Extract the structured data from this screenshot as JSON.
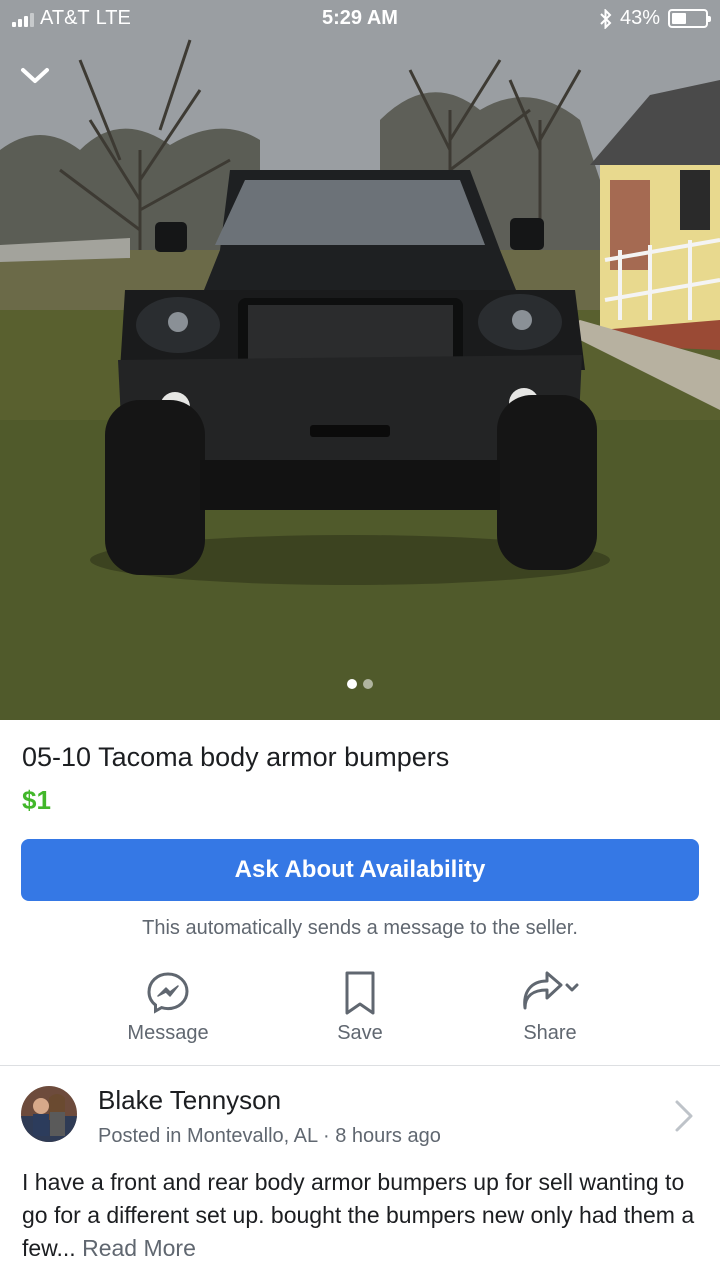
{
  "status_bar": {
    "carrier": "AT&T",
    "network": "LTE",
    "time": "5:29 AM",
    "battery_percent": "43%",
    "battery_level": 0.43
  },
  "photo": {
    "carousel_count": 2,
    "active_index": 0
  },
  "listing": {
    "title": "05-10 Tacoma body armor bumpers",
    "price": "$1",
    "ask_button": "Ask About Availability",
    "auto_note": "This automatically sends a message to the seller."
  },
  "actions": {
    "message": "Message",
    "save": "Save",
    "share": "Share"
  },
  "seller": {
    "name": "Blake Tennyson",
    "location": "Posted in Montevallo, AL",
    "separator": "·",
    "time_ago": "8 hours ago"
  },
  "description": {
    "text": "I have a front and rear body armor bumpers up for sell wanting to go for a different set up. bought the bumpers new  only had them a few...",
    "read_more": "Read More"
  },
  "colors": {
    "accent": "#3578e5",
    "price": "#42b72a",
    "secondary_text": "#606770"
  }
}
